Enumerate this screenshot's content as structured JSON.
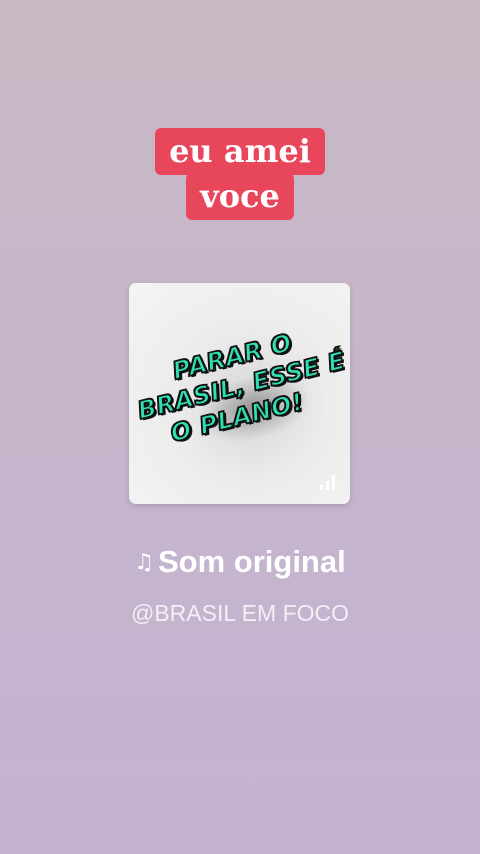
{
  "caption": {
    "line1": "eu amei",
    "line2": "voce",
    "background_color": "#e8465b",
    "text_color": "#ffffff"
  },
  "album": {
    "cover_text": [
      "PARAR O",
      "BRASIL, ESSE É",
      "O PLANO!"
    ],
    "cover_text_color": "#2fe0b4",
    "icon": "signal-bars-icon"
  },
  "sound": {
    "icon": "music-note-icon",
    "note_glyph": "♫",
    "title": "Som original",
    "author": "@BRASIL EM FOCO"
  },
  "colors": {
    "background_top": "#c9b8c3",
    "background_bottom": "#c3b2d2"
  }
}
